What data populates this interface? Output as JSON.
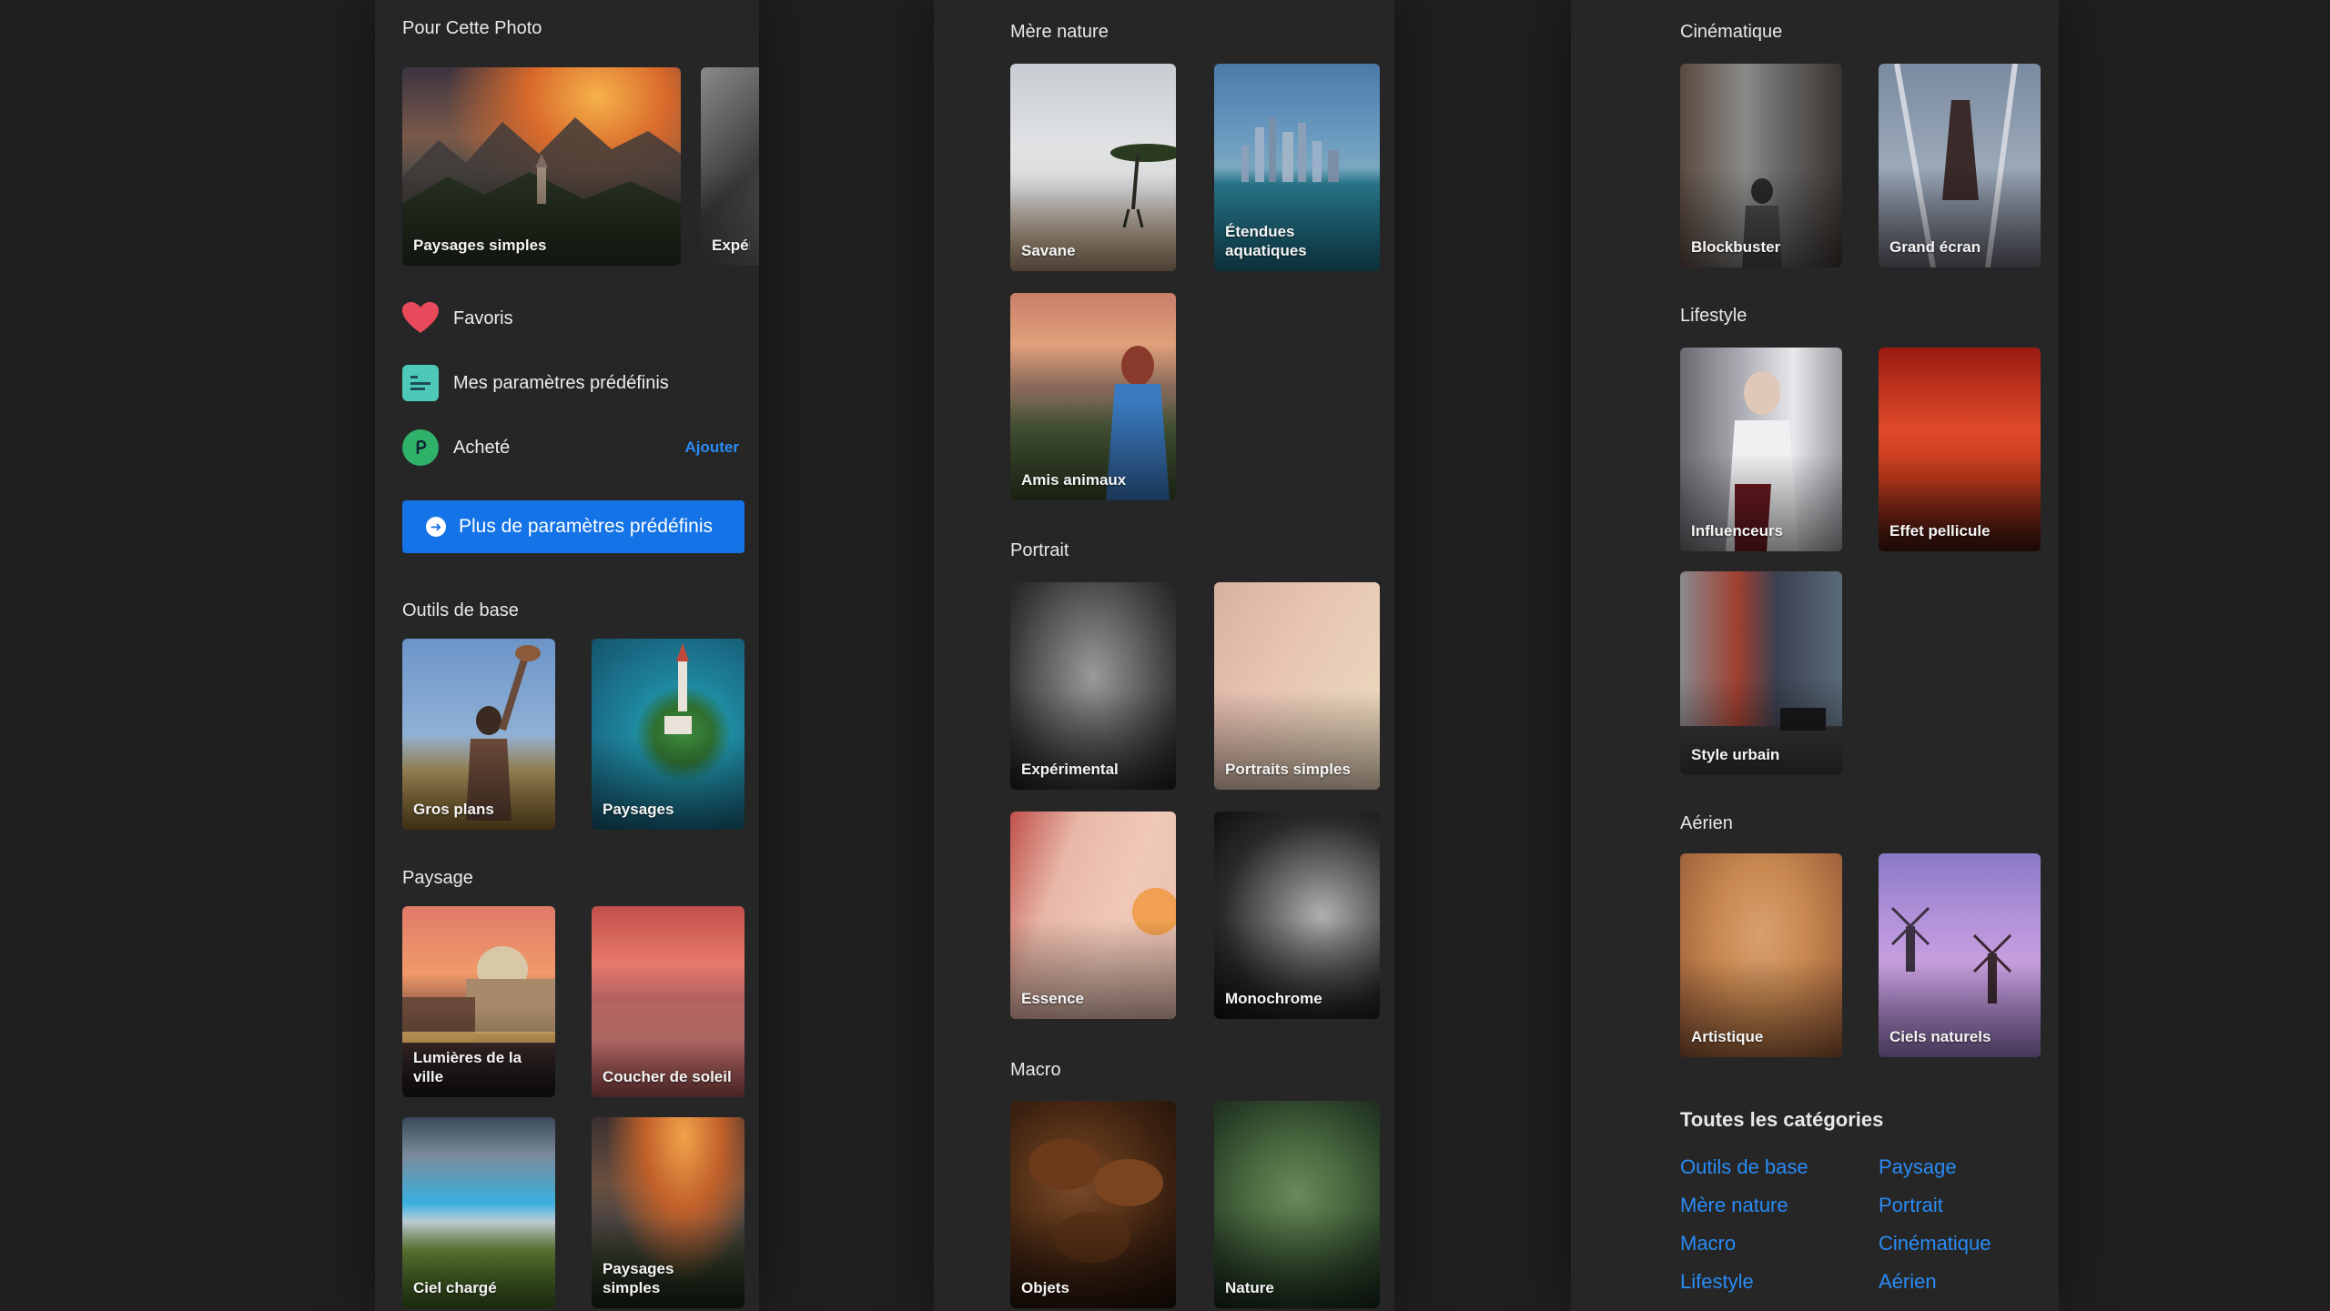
{
  "for_photo": {
    "title": "Pour Cette Photo",
    "cards": [
      "Paysages simples",
      "Expéri"
    ]
  },
  "menu": {
    "favorites": "Favoris",
    "my_presets": "Mes paramètres prédéfinis",
    "purchased": "Acheté",
    "add": "Ajouter"
  },
  "more_presets_button": "Plus de paramètres prédéfinis",
  "basic_tools": {
    "title": "Outils de base",
    "cards": [
      "Gros plans",
      "Paysages"
    ]
  },
  "landscape": {
    "title": "Paysage",
    "cards": [
      "Lumières de la ville",
      "Coucher de soleil",
      "Ciel chargé",
      "Paysages simples"
    ]
  },
  "nature": {
    "title": "Mère nature",
    "cards": [
      "Savane",
      "Étendues aquatiques",
      "Amis animaux"
    ]
  },
  "portrait": {
    "title": "Portrait",
    "cards": [
      "Expérimental",
      "Portraits simples",
      "Essence",
      "Monochrome"
    ]
  },
  "macro": {
    "title": "Macro",
    "cards": [
      "Objets",
      "Nature"
    ]
  },
  "cinematic": {
    "title": "Cinématique",
    "cards": [
      "Blockbuster",
      "Grand écran"
    ]
  },
  "lifestyle": {
    "title": "Lifestyle",
    "cards": [
      "Influenceurs",
      "Effet pellicule",
      "Style urbain"
    ]
  },
  "aerial": {
    "title": "Aérien",
    "cards": [
      "Artistique",
      "Ciels naturels"
    ]
  },
  "all_categories": {
    "title": "Toutes les catégories",
    "links": [
      "Outils de base",
      "Paysage",
      "Mère nature",
      "Portrait",
      "Macro",
      "Cinématique",
      "Lifestyle",
      "Aérien"
    ]
  },
  "colors": {
    "accent": "#1473e6",
    "link": "#2a8bf5",
    "heart": "#e8495b",
    "background": "#1f1f1f",
    "panel": "#262626"
  }
}
